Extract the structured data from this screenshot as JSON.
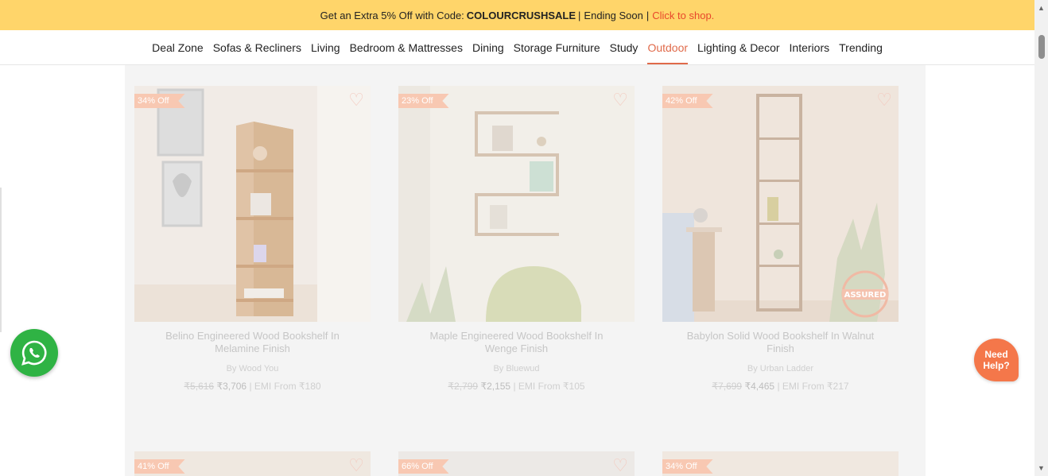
{
  "promo": {
    "text": "Get an Extra 5% Off with Code:",
    "code": "COLOURCRUSHSALE",
    "ending": "Ending Soon",
    "link": "Click to shop.",
    "sep1": "|",
    "sep2": "|"
  },
  "nav": {
    "items": [
      "Deal Zone",
      "Sofas & Recliners",
      "Living",
      "Bedroom & Mattresses",
      "Dining",
      "Storage Furniture",
      "Study",
      "Outdoor",
      "Lighting & Decor",
      "Interiors",
      "Trending"
    ],
    "active": "Outdoor"
  },
  "products": [
    {
      "discount": "34% Off",
      "title": "Belino Engineered Wood Bookshelf In Melamine Finish",
      "brand": "By Wood You",
      "mrp": "₹5,616",
      "price": "₹3,706",
      "emi": "| EMI From ₹180"
    },
    {
      "discount": "23% Off",
      "title": "Maple Engineered Wood Bookshelf In Wenge Finish",
      "brand": "By Bluewud",
      "mrp": "₹2,799",
      "price": "₹2,155",
      "emi": "| EMI From ₹105"
    },
    {
      "discount": "42% Off",
      "title": "Babylon Solid Wood Bookshelf In Walnut Finish",
      "brand": "By Urban Ladder",
      "mrp": "₹7,699",
      "price": "₹4,465",
      "emi": "| EMI From ₹217"
    },
    {
      "discount": "41% Off"
    },
    {
      "discount": "66% Off"
    },
    {
      "discount": "34% Off"
    }
  ],
  "assured": "ASSURED",
  "help": "Need Help?",
  "icons": {
    "heart": "heart-icon",
    "whatsapp": "whatsapp-icon",
    "scroll_up": "scroll-up-arrow-icon",
    "scroll_down": "scroll-down-arrow-icon"
  },
  "colors": {
    "promo_bg": "#ffd56a",
    "accent": "#e06a4a",
    "whatsapp": "#2fb344",
    "help": "#f4774a"
  }
}
